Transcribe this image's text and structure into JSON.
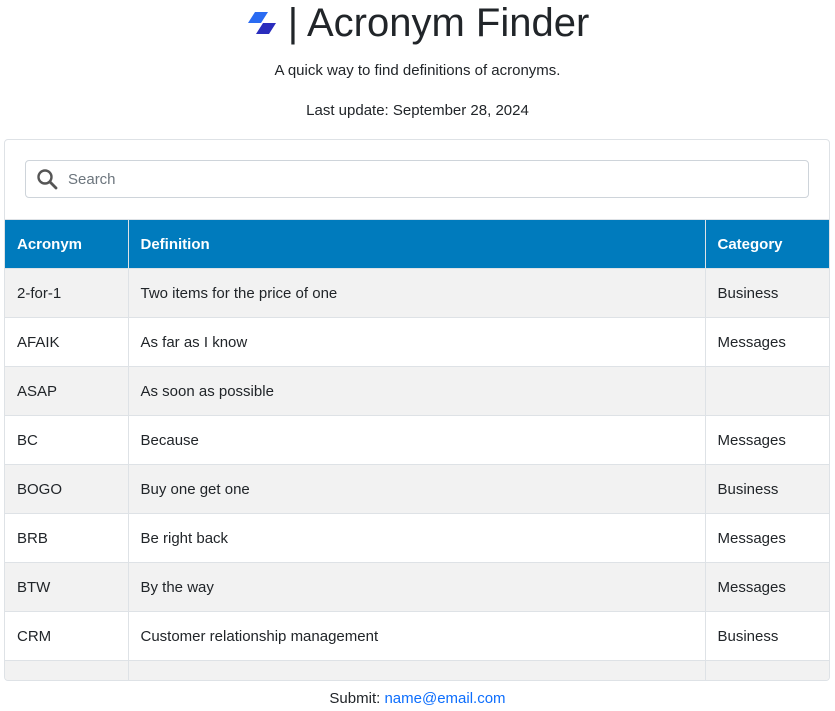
{
  "header": {
    "title": "| Acronym Finder",
    "subtitle": "A quick way to find definitions of acronyms.",
    "last_update": "Last update: September 28, 2024"
  },
  "search": {
    "placeholder": "Search"
  },
  "table": {
    "columns": [
      "Acronym",
      "Definition",
      "Category"
    ],
    "rows": [
      [
        "2-for-1",
        "Two items for the price of one",
        "Business"
      ],
      [
        "AFAIK",
        "As far as I know",
        "Messages"
      ],
      [
        "ASAP",
        "As soon as possible",
        ""
      ],
      [
        "BC",
        "Because",
        "Messages"
      ],
      [
        "BOGO",
        "Buy one get one",
        "Business"
      ],
      [
        "BRB",
        "Be right back",
        "Messages"
      ],
      [
        "BTW",
        "By the way",
        "Messages"
      ],
      [
        "CRM",
        "Customer relationship management",
        "Business"
      ]
    ]
  },
  "footer": {
    "label": "Submit:",
    "email": "name@email.com"
  },
  "colors": {
    "header_bg": "#007bbd",
    "stripe": "#f2f2f2",
    "link": "#0d6efd"
  }
}
